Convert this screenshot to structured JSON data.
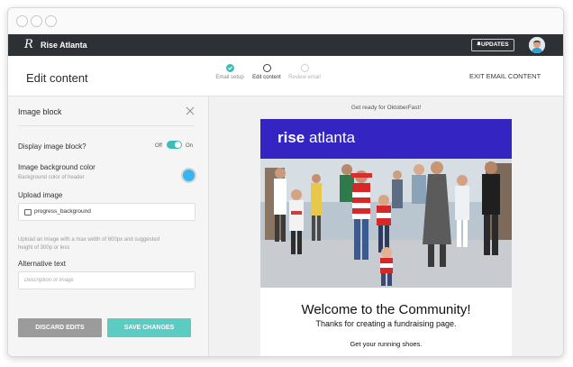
{
  "window": {
    "controls": [
      "close",
      "minimize",
      "maximize"
    ]
  },
  "topnav": {
    "logo_mark": "R",
    "org_name": "Rise Atlanta",
    "updates_label": "UPDATES",
    "updates_icon": "bell-icon",
    "avatar_icon": "user-avatar"
  },
  "header": {
    "title": "Edit content",
    "steps": [
      {
        "label": "Email setup",
        "state": "complete"
      },
      {
        "label": "Edit content",
        "state": "current"
      },
      {
        "label": "Review email",
        "state": "upcoming"
      }
    ],
    "exit_label": "EXIT EMAIL CONTENT"
  },
  "panel": {
    "title": "Image block",
    "close_icon": "close-icon",
    "display_label": "Display image block?",
    "toggle_off_label": "Off",
    "toggle_on_label": "On",
    "toggle_state": "on",
    "bg_color_label": "Image background color",
    "bg_color_sublabel": "Background color of header",
    "bg_color_value": "#38b5ef",
    "upload_label": "Upload image",
    "upload_value": "progress_background",
    "upload_icon": "image-icon",
    "upload_help": "Upload an image with a max width of 600px and suggested height of 300p or less",
    "alt_label": "Alternative text",
    "alt_placeholder": "Description of image",
    "discard_label": "DISCARD EDITS",
    "save_label": "SAVE CHANGES"
  },
  "preview": {
    "preheader": "Get ready for OktoberFast!",
    "brand_bold": "rise",
    "brand_light": "atlanta",
    "brand_color": "#3425c2",
    "hero_image": "crowd-of-runners-photo",
    "welcome_title": "Welcome to the Community!",
    "subtitle": "Thanks for creating a fundraising page.",
    "body_line": "Get your running shoes."
  },
  "colors": {
    "accent": "#3dbdba",
    "discard_button": "#9b9b9b",
    "save_button": "#5cccc3",
    "nav_bar": "#2d3035"
  }
}
